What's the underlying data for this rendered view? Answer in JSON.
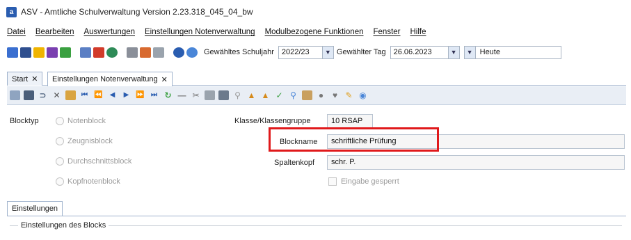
{
  "window": {
    "title": "ASV - Amtliche Schulverwaltung Version 2.23.318_045_04_bw",
    "icon_letter": "a"
  },
  "menu": [
    "Datei",
    "Bearbeiten",
    "Auswertungen",
    "Einstellungen Notenverwaltung",
    "Modulbezogene Funktionen",
    "Fenster",
    "Hilfe"
  ],
  "toolbar": {
    "schuljahr_label": "Gewähltes Schuljahr",
    "schuljahr_value": "2022/23",
    "tag_label": "Gewählter Tag",
    "tag_value": "26.06.2023",
    "heute_value": "Heute"
  },
  "tabs": [
    {
      "label": "Start"
    },
    {
      "label": "Einstellungen Notenverwaltung"
    }
  ],
  "form": {
    "blocktyp_label": "Blocktyp",
    "blocktyp_options": [
      "Notenblock",
      "Zeugnisblock",
      "Durchschnittsblock",
      "Kopfnotenblock"
    ],
    "klasse_label": "Klasse/Klassengruppe",
    "klasse_value": "10 RSAP",
    "blockname_label": "Blockname",
    "blockname_value": "schriftliche Prüfung",
    "spaltenkopf_label": "Spaltenkopf",
    "spaltenkopf_value": "schr. P.",
    "eingabe_gesperrt_label": "Eingabe gesperrt"
  },
  "subtabs": {
    "einstellungen": "Einstellungen"
  },
  "group": {
    "title": "Einstellungen des Blocks"
  },
  "colors": {
    "highlight": "#e0191b",
    "accent": "#2a5db0"
  }
}
